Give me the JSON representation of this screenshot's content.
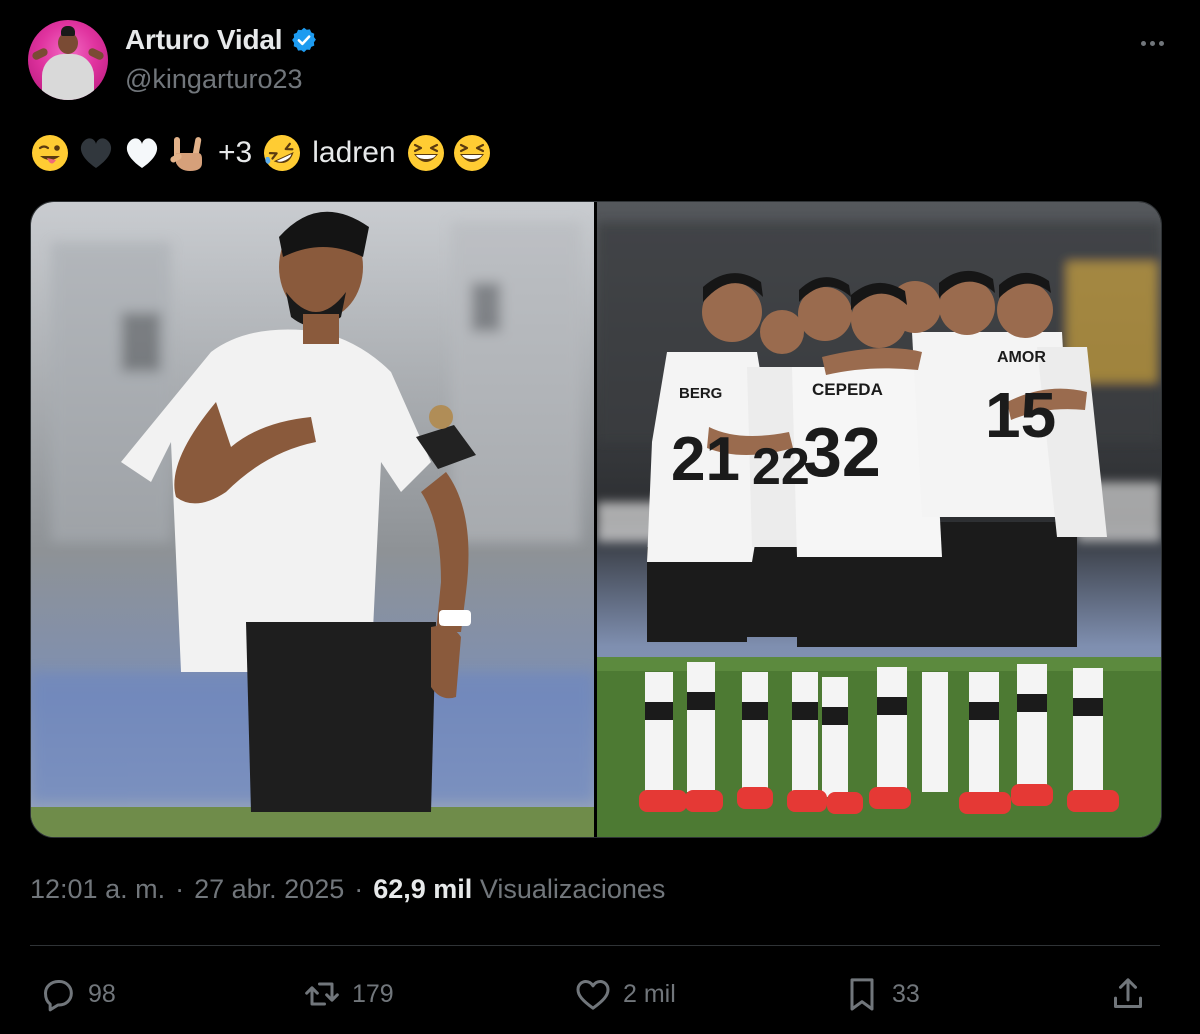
{
  "author": {
    "display_name": "Arturo Vidal",
    "handle": "@kingarturo23",
    "verified": true,
    "verified_color": "#1d9bf0"
  },
  "tweet": {
    "text_plus": "+3",
    "text_word": "ladren",
    "emojis": [
      "winking-tongue-emoji",
      "black-heart-emoji",
      "white-heart-emoji",
      "love-you-gesture-emoji",
      "rolling-laughing-emoji",
      "grinning-squinting-emoji",
      "grinning-squinting-emoji"
    ]
  },
  "media": {
    "photos": [
      {
        "name": "player-celebrating-photo"
      },
      {
        "name": "team-huddle-photo",
        "jersey_numbers": [
          "21",
          "22",
          "32",
          "15"
        ],
        "jersey_names": [
          "BERG",
          "CEPEDA",
          "AMOR"
        ]
      }
    ]
  },
  "meta": {
    "time": "12:01 a. m.",
    "separator": "·",
    "date": "27 abr. 2025",
    "views_count": "62,9 mil",
    "views_label": "Visualizaciones"
  },
  "actions": {
    "replies": "98",
    "reposts": "179",
    "likes": "2 mil",
    "bookmarks": "33"
  },
  "colors": {
    "background": "#000000",
    "text_primary": "#e7e9ea",
    "text_secondary": "#71767b",
    "divider": "#2f3336",
    "accent": "#1d9bf0"
  }
}
